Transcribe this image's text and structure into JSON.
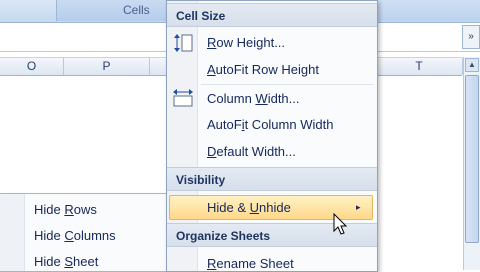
{
  "ribbon": {
    "group_label": "Cells"
  },
  "formula_bar": {
    "expand_symbol": "»"
  },
  "columns": [
    "O",
    "P",
    "T"
  ],
  "scrollbar": {
    "up_arrow": "▲"
  },
  "menu": {
    "sections": {
      "cell_size": "Cell Size",
      "visibility": "Visibility",
      "organize": "Organize Sheets"
    },
    "items": {
      "row_height": {
        "pre": "",
        "key": "R",
        "post": "ow Height..."
      },
      "autofit_row": {
        "pre": "",
        "key": "A",
        "post": "utoFit Row Height"
      },
      "column_width": {
        "pre": "Column ",
        "key": "W",
        "post": "idth..."
      },
      "autofit_col": {
        "pre": "AutoF",
        "key": "i",
        "post": "t Column Width"
      },
      "default_width": {
        "pre": "",
        "key": "D",
        "post": "efault Width..."
      },
      "hide_unhide": {
        "pre": "Hide & ",
        "key": "U",
        "post": "nhide"
      },
      "rename_sheet": {
        "pre": "",
        "key": "R",
        "post": "ename Sheet"
      }
    },
    "submenu_arrow": "▸"
  },
  "submenu": {
    "hide_rows": {
      "pre": "Hide ",
      "key": "R",
      "post": "ows"
    },
    "hide_columns": {
      "pre": "Hide ",
      "key": "C",
      "post": "olumns"
    },
    "hide_sheet": {
      "pre": "Hide ",
      "key": "S",
      "post": "heet"
    }
  },
  "colors": {
    "highlight": "#ffd88a",
    "section_bg": "#dce4ef",
    "accent": "#15285a"
  },
  "icons": [
    "row-height-icon",
    "column-width-icon",
    "mouse-pointer-icon"
  ]
}
